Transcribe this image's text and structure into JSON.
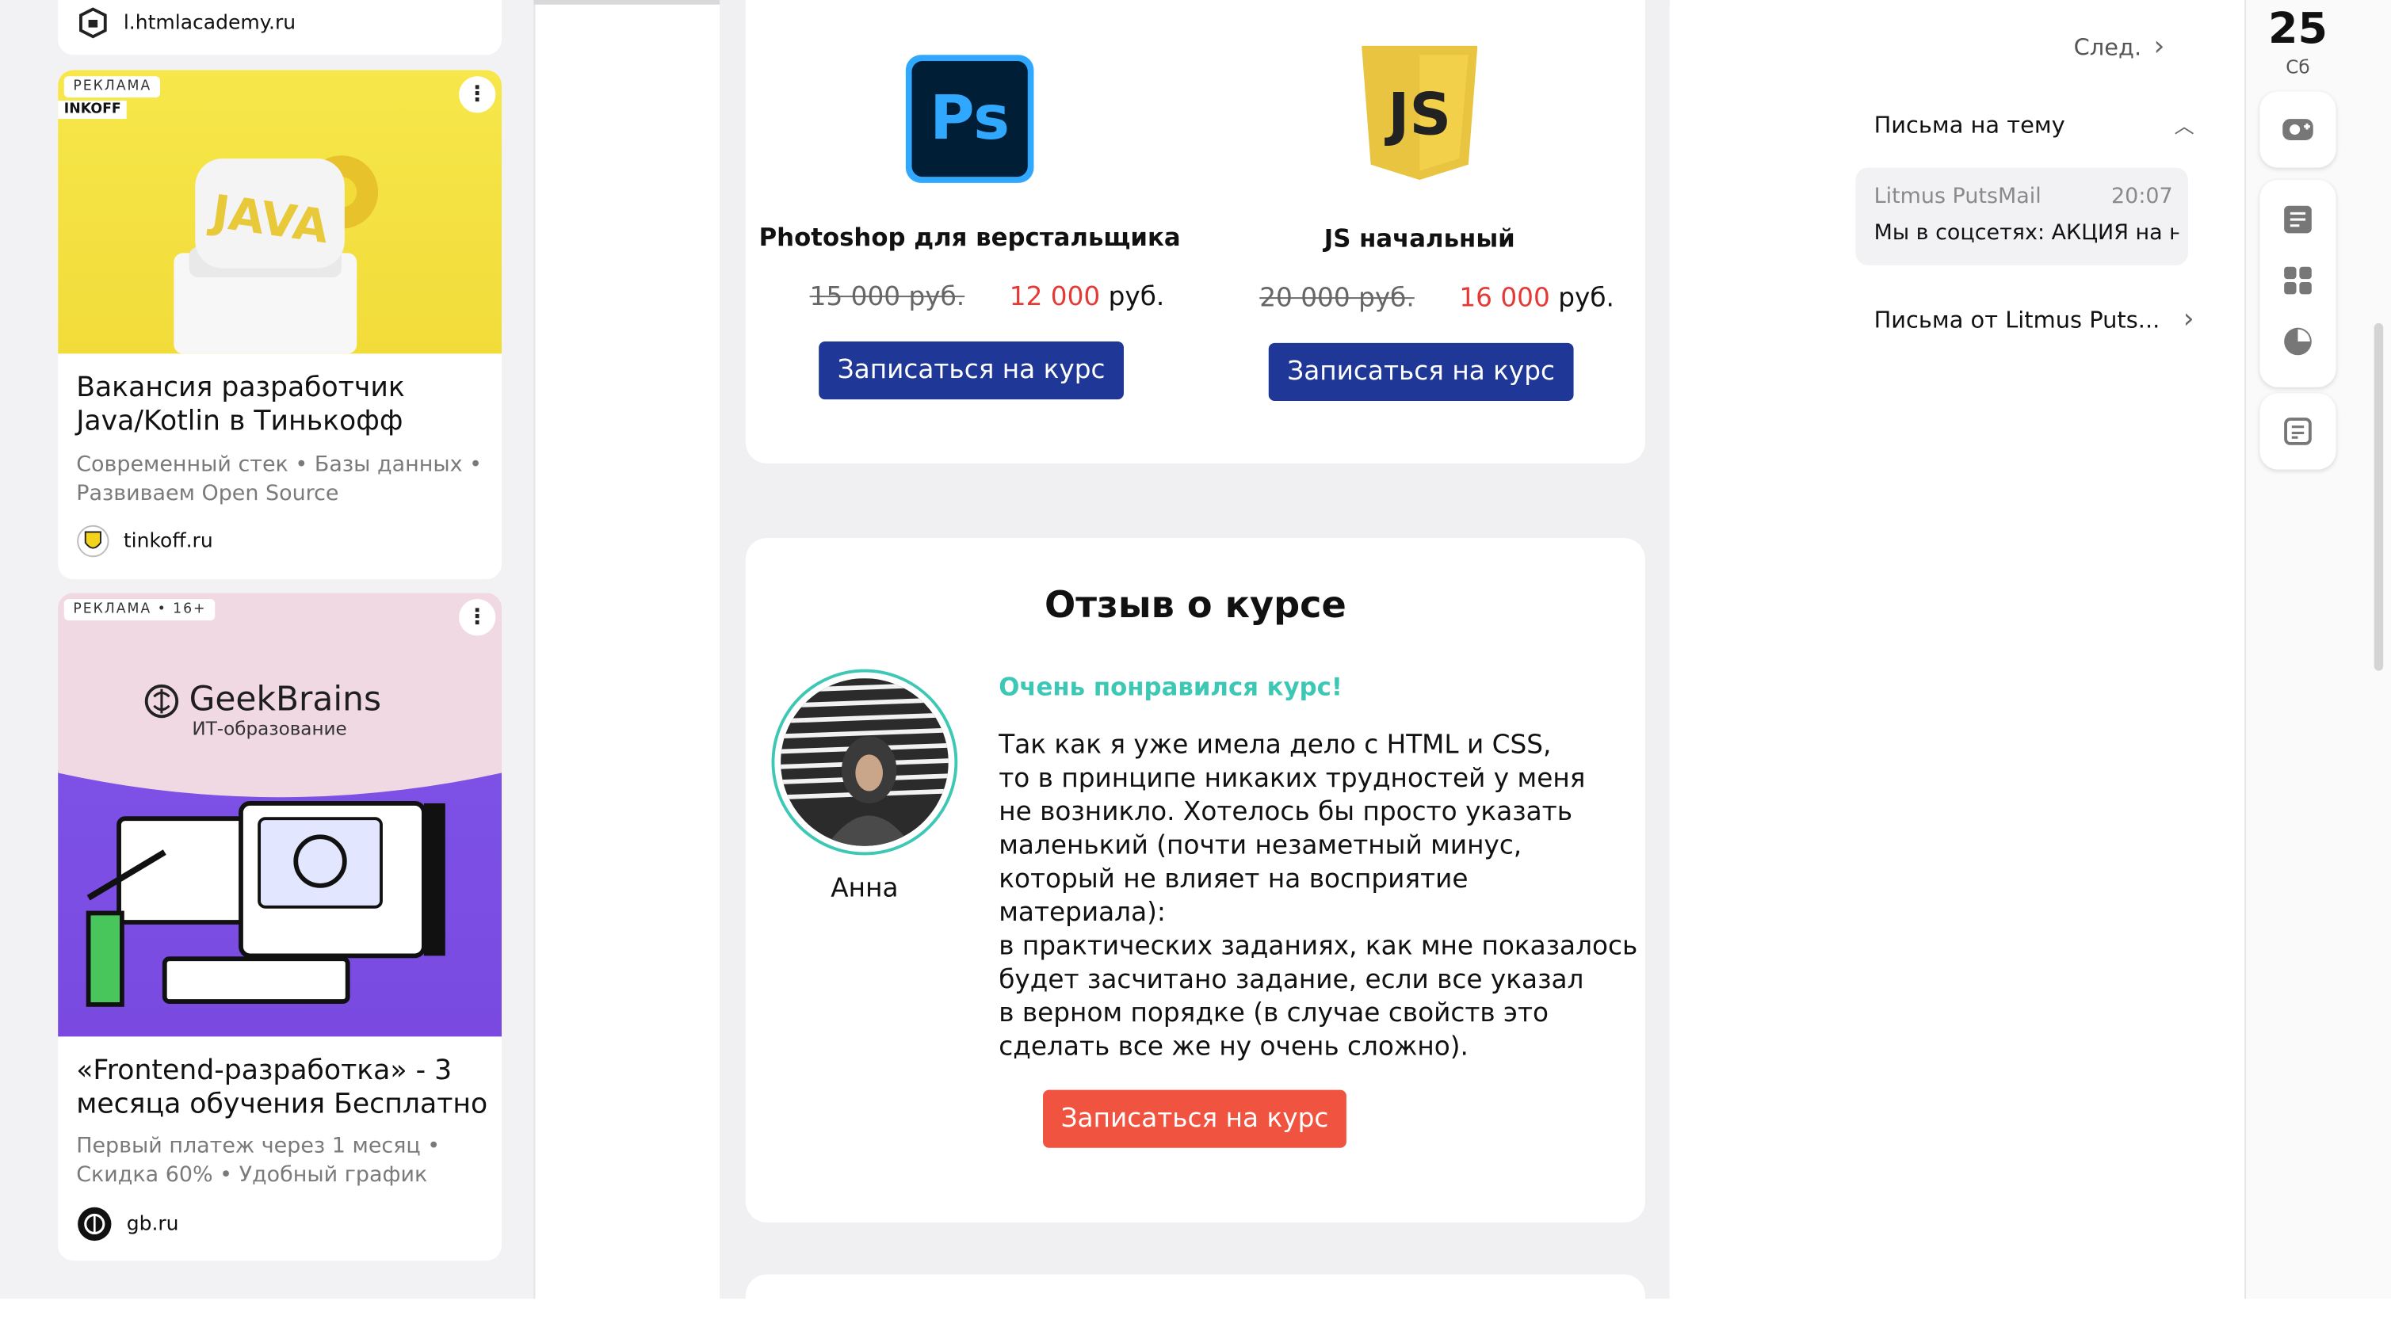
{
  "ads": [
    {
      "source": "l.htmlacademy.ru"
    },
    {
      "badge": "РЕКЛАМА",
      "brand": "INKOFF",
      "image_text": "JAVA",
      "title": "Вакансия разработчик Java/Kotlin в Тинькофф",
      "subtitle": "Современный стек • Базы данных • Развиваем Open Source",
      "source": "tinkoff.ru"
    },
    {
      "badge": "РЕКЛАМА • 16+",
      "brand": "GeekBrains",
      "brand_sub": "ИТ-образование",
      "title": "«Frontend-разработка» - 3 месяца обучения Бесплатно",
      "subtitle": "Первый платеж через 1 месяц • Скидка 60% • Удобный график",
      "source": "gb.ru"
    }
  ],
  "courses": [
    {
      "logo": "Ps",
      "title": "Photoshop для верстальщика",
      "old_price": "15 000 руб.",
      "new_price": "12 000",
      "currency": "руб.",
      "button": "Записаться на курс"
    },
    {
      "logo": "JS",
      "title": "JS начальный",
      "old_price": "20 000 руб.",
      "new_price": "16 000",
      "currency": "руб.",
      "button": "Записаться на курс"
    }
  ],
  "review": {
    "heading": "Отзыв о курсе",
    "author": "Анна",
    "tagline": "Очень понравился курс!",
    "lines": [
      "Так как я уже имела дело с HTML и CSS,",
      "то в принципе никаких трудностей у меня",
      "не возникло. Хотелось бы просто указать",
      "маленький (почти незаметный минус,",
      "который не влияет на восприятие материала):",
      "в практических заданиях, как мне показалось",
      "будет засчитано задание, если все указал",
      "в верном порядке (в случае свойств это",
      "сделать все же ну очень сложно)."
    ],
    "button": "Записаться на курс"
  },
  "sidebar": {
    "next_label": "След.",
    "thread_header": "Письма на тему",
    "thread_item": {
      "sender": "Litmus PutsMail",
      "time": "20:07",
      "subject": "Мы в соцсетях: АКЦИЯ на на..."
    },
    "from_sender": "Письма от Litmus Puts..."
  },
  "date": {
    "day": "25",
    "weekday": "Сб"
  },
  "colors": {
    "accent_blue": "#1f3796",
    "accent_red": "#f0533f",
    "price_red": "#e53935",
    "teal": "#3cc8b4"
  },
  "icons": {
    "rail": [
      "camera-icon",
      "notes-icon",
      "apps-icon",
      "pie-chart-icon",
      "document-icon"
    ]
  }
}
